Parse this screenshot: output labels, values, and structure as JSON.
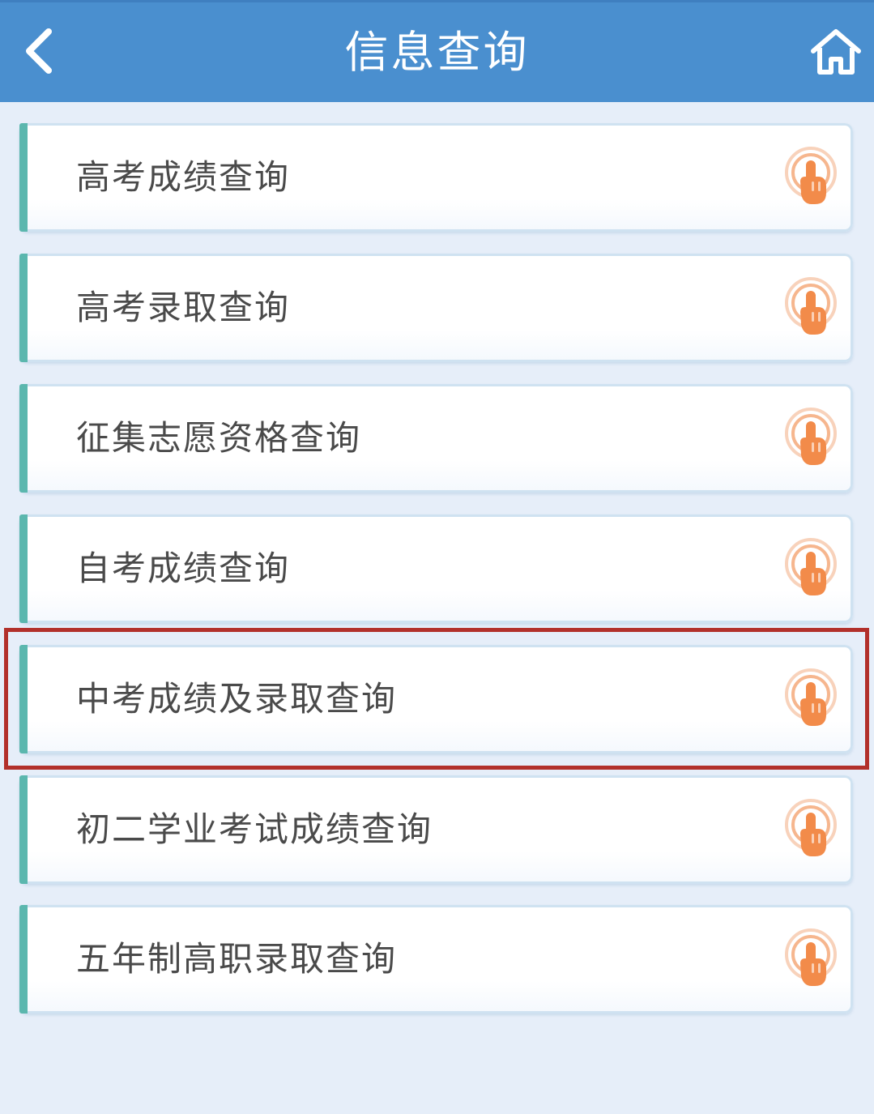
{
  "header": {
    "title": "信息查询",
    "back_icon": "chevron-left-icon",
    "home_icon": "home-icon"
  },
  "menu": {
    "items": [
      {
        "label": "高考成绩查询"
      },
      {
        "label": "高考录取查询"
      },
      {
        "label": "征集志愿资格查询"
      },
      {
        "label": "自考成绩查询"
      },
      {
        "label": "中考成绩及录取查询",
        "highlighted": true
      },
      {
        "label": "初二学业考试成绩查询"
      },
      {
        "label": "五年制高职录取查询"
      }
    ],
    "item_icon": "tap-finger-icon"
  },
  "colors": {
    "header_bg": "#4a8fcf",
    "page_bg": "#e6eef9",
    "accent": "#5bb7ae",
    "icon_orange": "#f28b4a",
    "highlight": "#b2302b"
  }
}
